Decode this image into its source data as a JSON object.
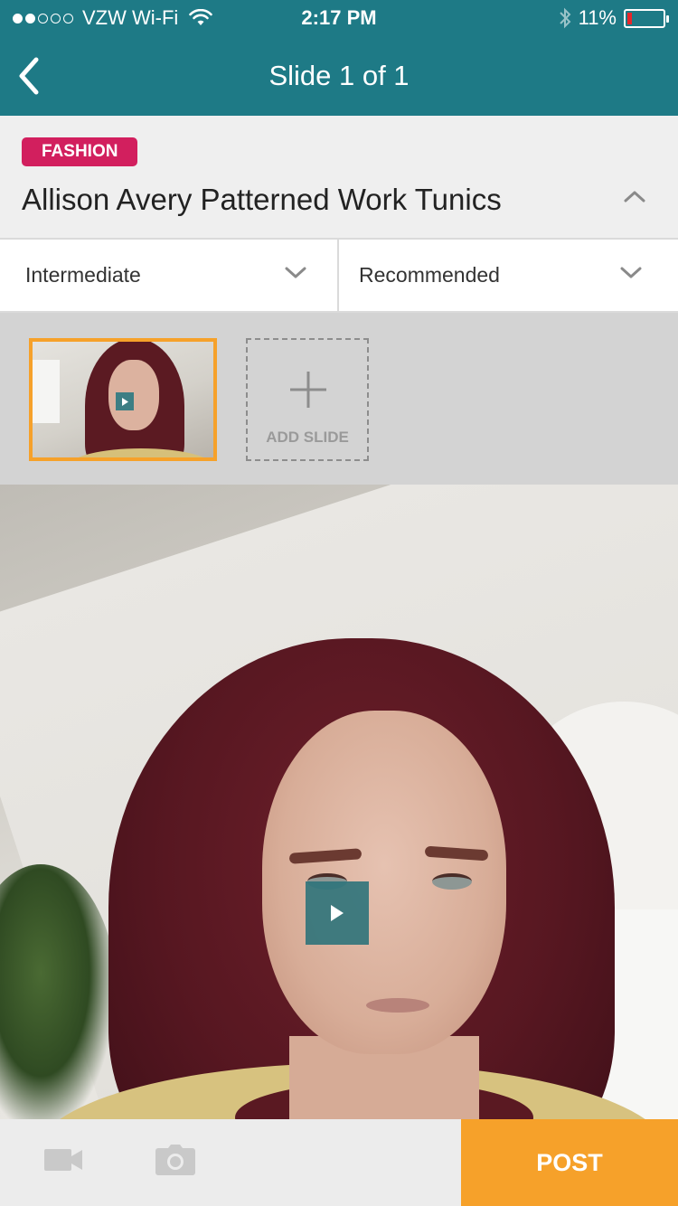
{
  "status_bar": {
    "carrier": "VZW Wi-Fi",
    "time": "2:17 PM",
    "battery": "11%",
    "signal_bars_filled": 2,
    "signal_bars_total": 5
  },
  "nav": {
    "title": "Slide 1 of 1",
    "back_icon": "chevron-left-icon"
  },
  "post": {
    "category": "FASHION",
    "category_color": "#d21f5e",
    "title": "Allison Avery Patterned Work Tunics",
    "collapse_icon": "chevron-up-icon"
  },
  "filters": {
    "level": "Intermediate",
    "sort": "Recommended"
  },
  "slides": {
    "add_label": "ADD SLIDE",
    "selected_index": 0
  },
  "bottom_bar": {
    "video_icon": "video-camera-icon",
    "photo_icon": "camera-icon",
    "post_label": "POST"
  },
  "colors": {
    "header": "#1e7a86",
    "accent": "#f6a12a",
    "play": "#2d737a"
  }
}
